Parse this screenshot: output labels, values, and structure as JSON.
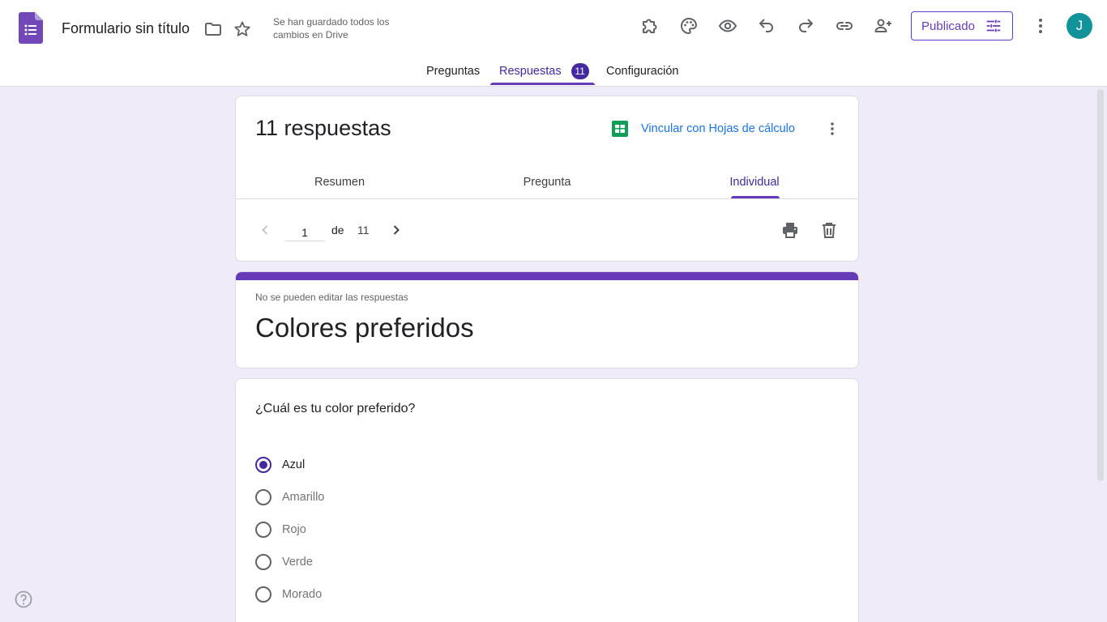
{
  "header": {
    "title": "Formulario sin título",
    "save_status": "Se han guardado todos los cambios en Drive",
    "publish_label": "Publicado",
    "avatar_initial": "J",
    "icons": [
      "forms-logo-icon",
      "folder-icon",
      "star-icon",
      "addons-icon",
      "palette-icon",
      "preview-eye-icon",
      "undo-icon",
      "redo-icon",
      "link-icon",
      "add-collaborator-icon",
      "publish-settings-icon",
      "more-vert-icon"
    ]
  },
  "main_tabs": [
    {
      "label": "Preguntas"
    },
    {
      "label": "Respuestas",
      "badge": "11",
      "active": true
    },
    {
      "label": "Configuración"
    }
  ],
  "responses": {
    "count_label": "11 respuestas",
    "sheets_link": "Vincular con Hojas de cálculo",
    "sub_tabs": [
      {
        "label": "Resumen"
      },
      {
        "label": "Pregunta"
      },
      {
        "label": "Individual",
        "active": true
      }
    ],
    "pager": {
      "current": "1",
      "of_label": "de",
      "total": "11"
    }
  },
  "form": {
    "notice": "No se pueden editar las respuestas",
    "title": "Colores preferidos",
    "accent_color": "#673ab7"
  },
  "question": {
    "text": "¿Cuál es tu color preferido?",
    "options": [
      {
        "label": "Azul",
        "selected": true
      },
      {
        "label": "Amarillo",
        "selected": false
      },
      {
        "label": "Rojo",
        "selected": false
      },
      {
        "label": "Verde",
        "selected": false
      },
      {
        "label": "Morado",
        "selected": false
      }
    ]
  },
  "colors": {
    "page_background": "#f0ebf8",
    "accent": "#673ab7",
    "link": "#1a73e8",
    "avatar": "#12939a"
  }
}
